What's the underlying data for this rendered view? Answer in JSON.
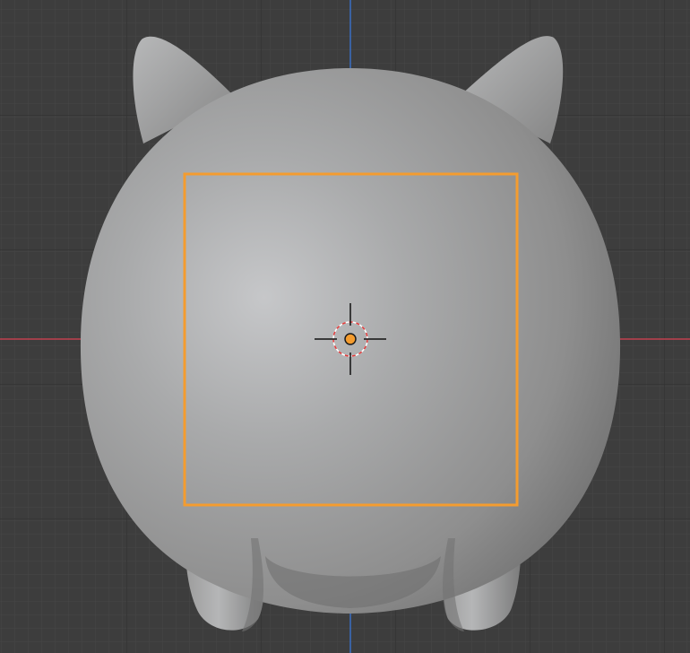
{
  "viewport": {
    "background_color": "#3d3d3d",
    "grid": true,
    "grid_minor_color": "#454545",
    "grid_major_color": "#353535",
    "x_axis_color": "#c2404e",
    "y_axis_color": "#3a6fc4"
  },
  "object": {
    "shape": "rounded creature with two ears and two legs (subdivided mesh)",
    "shading": "solid",
    "base_color": "#8c8c8c",
    "highlight_color": "#c9cacc",
    "shadow_color": "#6b6b6b"
  },
  "selection_box": {
    "color": "#f49c2f"
  },
  "origin_marker": {
    "color": "#f49c2f"
  },
  "cursor_3d": {
    "ring_color_primary": "#e23a3a",
    "ring_color_secondary": "#ffffff",
    "crosshair_color": "#111111"
  }
}
